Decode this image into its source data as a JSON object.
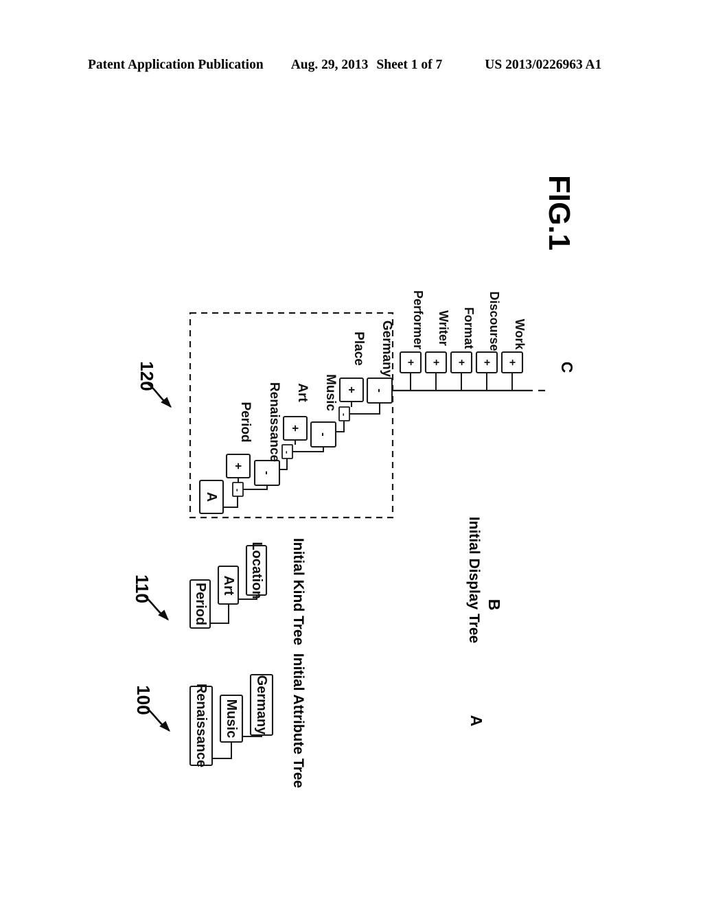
{
  "header": {
    "publication": "Patent Application Publication",
    "date": "Aug. 29, 2013",
    "sheet": "Sheet 1 of 7",
    "doc_number": "US 2013/0226963 A1"
  },
  "figure": {
    "label": "FIG.1"
  },
  "panels": {
    "attribute_tree": {
      "ref": "100",
      "letter": "A",
      "caption": "Initial Attribute Tree",
      "nodes": [
        {
          "label": "Renaissance"
        },
        {
          "label": "Music"
        },
        {
          "label": "Germany"
        }
      ]
    },
    "kind_tree": {
      "ref": "110",
      "letter": "B",
      "caption": "Initial Kind Tree",
      "nodes": [
        {
          "label": "Period"
        },
        {
          "label": "Art"
        },
        {
          "label": "Location"
        }
      ]
    },
    "display_tree": {
      "ref": "120",
      "letter": "C",
      "caption": "Initial Display Tree",
      "root_label": "A",
      "levels": [
        {
          "kind": "Period",
          "kind_sign": "+",
          "attribute": "Renaissance",
          "attribute_sign": "-"
        },
        {
          "kind": "Art",
          "kind_sign": "+",
          "attribute": "Music",
          "attribute_sign": "-"
        },
        {
          "kind": "Place",
          "kind_sign": "+",
          "attribute": "Germany",
          "attribute_sign": "-"
        }
      ],
      "leaves": [
        {
          "label": "Performer",
          "sign": "+"
        },
        {
          "label": "Writer",
          "sign": "+"
        },
        {
          "label": "Format",
          "sign": "+"
        },
        {
          "label": "Discourse",
          "sign": "+"
        },
        {
          "label": "Work",
          "sign": "+"
        }
      ],
      "connector_sign": "-"
    }
  },
  "colors": {
    "ink": "#1a1a1a",
    "paper": "#ffffff"
  }
}
